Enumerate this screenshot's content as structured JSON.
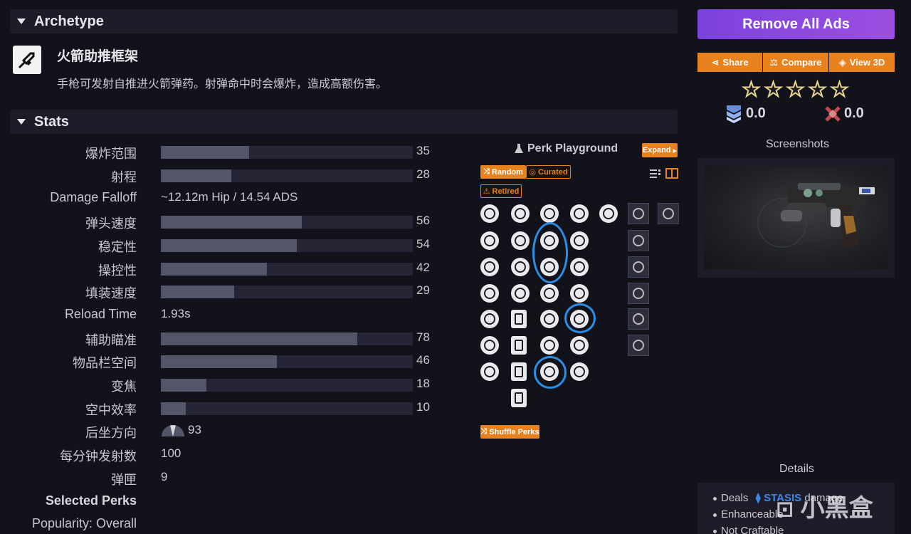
{
  "archetype": {
    "header": "Archetype",
    "name": "火箭助推框架",
    "description": "手枪可发射自推进火箭弹药。射弹命中时会爆炸，造成高额伤害。"
  },
  "stats": {
    "header": "Stats",
    "rows": [
      {
        "label": "爆炸范围",
        "value": "35",
        "fraction": 0.35
      },
      {
        "label": "射程",
        "value": "28",
        "fraction": 0.28
      },
      {
        "label": "Damage Falloff",
        "text": "~12.12m Hip / 14.54 ADS"
      },
      {
        "label": "弹头速度",
        "value": "56",
        "fraction": 0.56
      },
      {
        "label": "稳定性",
        "value": "54",
        "fraction": 0.54
      },
      {
        "label": "操控性",
        "value": "42",
        "fraction": 0.42
      },
      {
        "label": "填装速度",
        "value": "29",
        "fraction": 0.29
      },
      {
        "label": "Reload Time",
        "text": "1.93s"
      },
      {
        "label": "辅助瞄准",
        "value": "78",
        "fraction": 0.78
      },
      {
        "label": "物品栏空间",
        "value": "46",
        "fraction": 0.46
      },
      {
        "label": "变焦",
        "value": "18",
        "fraction": 0.18
      },
      {
        "label": "空中效率",
        "value": "10",
        "fraction": 0.1
      },
      {
        "label": "后坐方向",
        "recoil": "93"
      },
      {
        "label": "每分钟发射数",
        "text": "100"
      },
      {
        "label": "弹匣",
        "text": "9"
      }
    ],
    "selected_perks": "Selected Perks",
    "popularity": "Popularity: Overall"
  },
  "perk_playground": {
    "title": "Perk Playground",
    "expand": "Expand",
    "random": "Random",
    "curated": "Curated",
    "retired": "Retired",
    "shuffle": "Shuffle Perks"
  },
  "sidebar": {
    "remove_ads": "Remove All Ads",
    "share": "Share",
    "compare": "Compare",
    "view3d": "View 3D",
    "rating_left": "0.0",
    "rating_right": "0.0",
    "screenshots": "Screenshots",
    "details": "Details",
    "detail_items": [
      "Deals",
      "STASIS",
      "damage",
      "Enhanceable",
      "Not Craftable"
    ]
  },
  "watermark": "小黑盒",
  "colors": {
    "accent": "#e8821e",
    "purple": "#8a4ade",
    "ring": "#2a8ee6",
    "bar_fill": "#55556a"
  }
}
